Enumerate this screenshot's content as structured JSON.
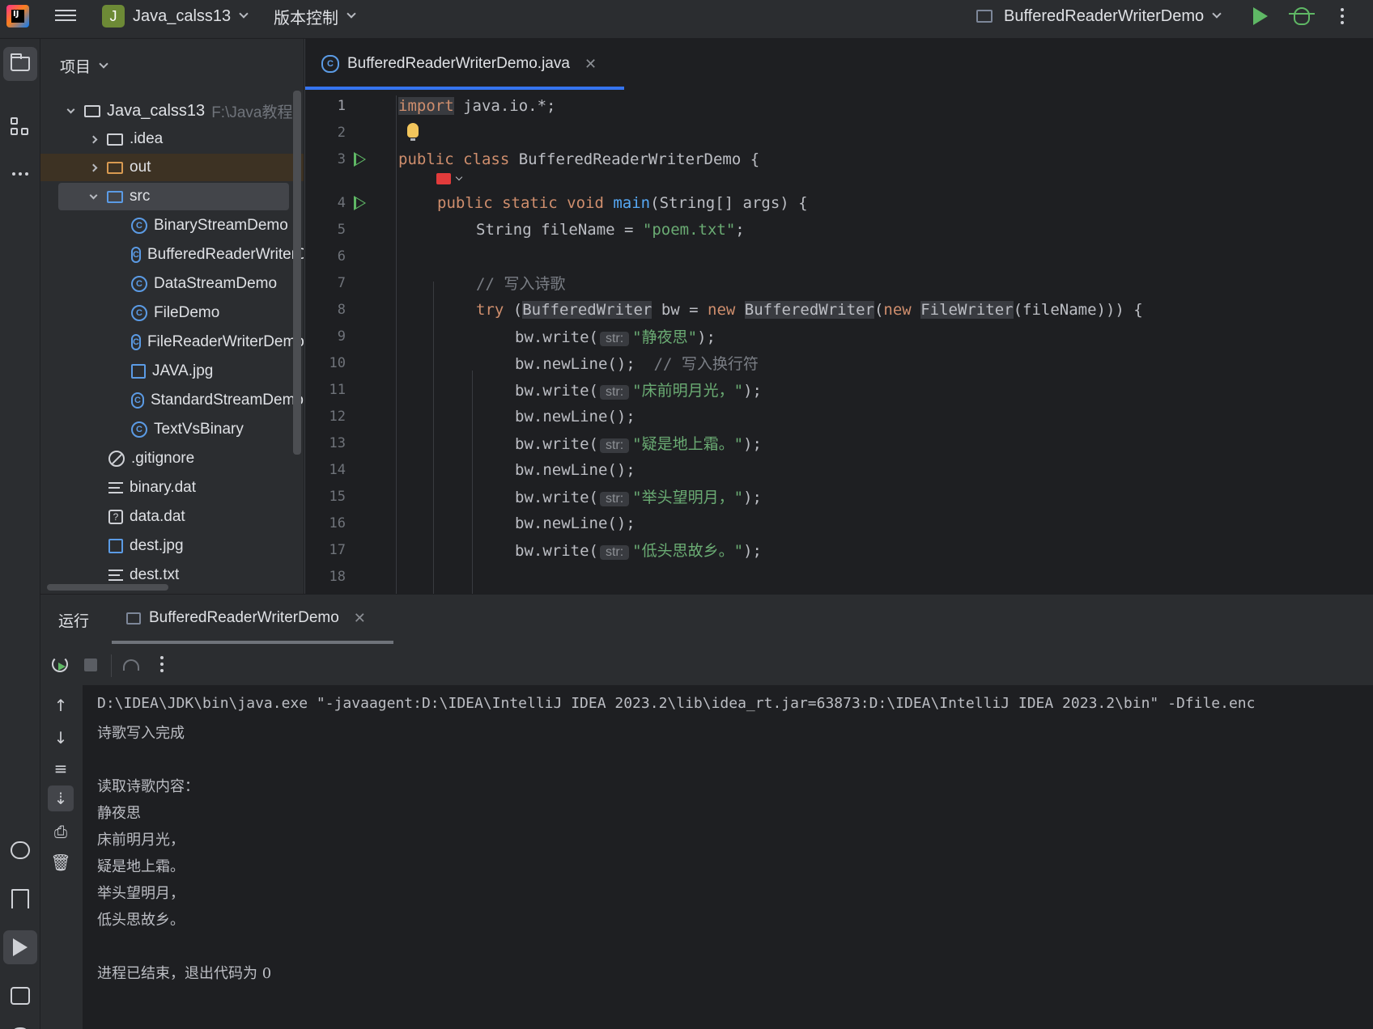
{
  "topbar": {
    "project_badge": "J",
    "project_name": "Java_calss13",
    "vcs_label": "版本控制",
    "run_config": "BufferedReaderWriterDemo"
  },
  "project_panel": {
    "header": "项目",
    "root_name": "Java_calss13",
    "root_path": "F:\\Java教程",
    "items": [
      {
        "label": ".idea"
      },
      {
        "label": "out"
      },
      {
        "label": "src"
      },
      {
        "label": "BinaryStreamDemo"
      },
      {
        "label": "BufferedReaderWriterDemo"
      },
      {
        "label": "DataStreamDemo"
      },
      {
        "label": "FileDemo"
      },
      {
        "label": "FileReaderWriterDemo"
      },
      {
        "label": "JAVA.jpg"
      },
      {
        "label": "StandardStreamDemo"
      },
      {
        "label": "TextVsBinary"
      },
      {
        "label": ".gitignore"
      },
      {
        "label": "binary.dat"
      },
      {
        "label": "data.dat"
      },
      {
        "label": "dest.jpg"
      },
      {
        "label": "dest.txt"
      }
    ]
  },
  "editor": {
    "tab_label": "BufferedReaderWriterDemo.java",
    "hint_label": "str:",
    "line_numbers": [
      "1",
      "2",
      "3",
      "4",
      "5",
      "6",
      "7",
      "8",
      "9",
      "10",
      "11",
      "12",
      "13",
      "14",
      "15",
      "16",
      "17",
      "18"
    ],
    "code": {
      "l1_kw": "import",
      "l1_rest": " java.io.*;",
      "l3_kw": "public class",
      "l3_rest": " BufferedReaderWriterDemo {",
      "l4_kw": "public static void",
      "l4_fn": "main",
      "l4_rest": "(String[] args) {",
      "l5_a": "String fileName = ",
      "l5_str": "\"poem.txt\"",
      "l5_b": ";",
      "l7_cm": "// 写入诗歌",
      "l8_try": "try",
      "l8_a": " (",
      "l8_t1": "BufferedWriter",
      "l8_b": " bw = ",
      "l8_new1": "new",
      "l8_sp": " ",
      "l8_t2": "BufferedWriter",
      "l8_c": "(",
      "l8_new2": "new",
      "l8_t3": "FileWriter",
      "l8_d": "(fileName))) {",
      "write": "bw.write(",
      "newline": "bw.newLine();",
      "l10_cm": "// 写入换行符",
      "close": ");",
      "s9": "\"静夜思\"",
      "s11": "\"床前明月光，\"",
      "s13": "\"疑是地上霜。\"",
      "s15": "\"举头望明月，\"",
      "s17": "\"低头思故乡。\""
    }
  },
  "run_panel": {
    "label": "运行",
    "tab_label": "BufferedReaderWriterDemo",
    "console_lines": [
      "D:\\IDEA\\JDK\\bin\\java.exe \"-javaagent:D:\\IDEA\\IntelliJ IDEA 2023.2\\lib\\idea_rt.jar=63873:D:\\IDEA\\IntelliJ IDEA 2023.2\\bin\" -Dfile.enc",
      "诗歌写入完成",
      "",
      "读取诗歌内容：",
      "静夜思",
      "床前明月光，",
      "疑是地上霜。",
      "举头望明月，",
      "低头思故乡。",
      "",
      "进程已结束，退出代码为 0"
    ]
  },
  "icons": {
    "logo": "intellij-logo",
    "run": "play-icon",
    "debug": "bug-icon",
    "accent": "#3574f0",
    "run_green": "#5fb865"
  }
}
